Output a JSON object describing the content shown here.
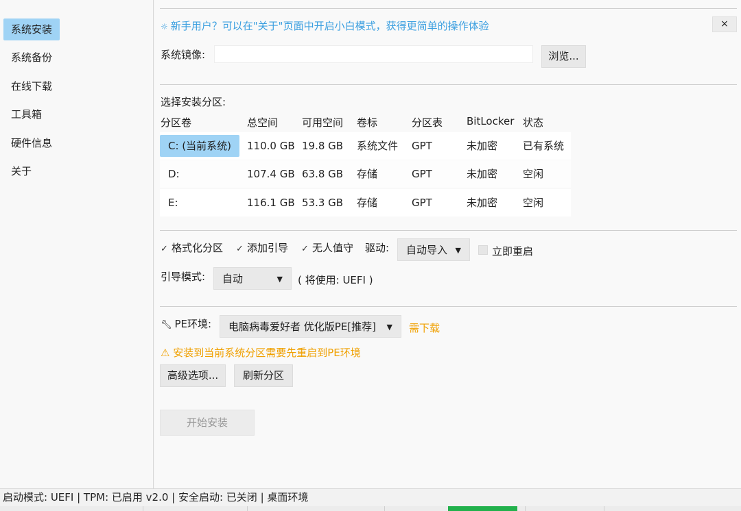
{
  "sidebar": {
    "items": [
      {
        "label": "系统安装",
        "active": true
      },
      {
        "label": "系统备份"
      },
      {
        "label": "在线下载"
      },
      {
        "label": "工具箱"
      },
      {
        "label": "硬件信息"
      },
      {
        "label": "关于"
      }
    ]
  },
  "tip": {
    "icon": "chat-bubble-icon",
    "text": "新手用户？可以在\"关于\"页面中开启小白模式，获得更简单的操作体验",
    "close_label": "×"
  },
  "image": {
    "label": "系统镜像:",
    "value": "",
    "browse_label": "浏览..."
  },
  "partitions": {
    "title": "选择安装分区:",
    "headers": [
      "分区卷",
      "总空间",
      "可用空间",
      "卷标",
      "分区表",
      "BitLocker",
      "状态"
    ],
    "rows": [
      {
        "volume": "C: (当前系统)",
        "total": "110.0 GB",
        "free": "19.8 GB",
        "label": "系统文件",
        "table": "GPT",
        "bitlocker": "未加密",
        "status": "已有系统",
        "selected": true
      },
      {
        "volume": "D:",
        "total": "107.4 GB",
        "free": "63.8 GB",
        "label": "存储",
        "table": "GPT",
        "bitlocker": "未加密",
        "status": "空闲"
      },
      {
        "volume": "E:",
        "total": "116.1 GB",
        "free": "53.3 GB",
        "label": "存储",
        "table": "GPT",
        "bitlocker": "未加密",
        "status": "空闲"
      }
    ]
  },
  "options": {
    "format": {
      "label": "格式化分区",
      "checked": true
    },
    "boot_add": {
      "label": "添加引导",
      "checked": true
    },
    "unattended": {
      "label": "无人值守",
      "checked": true
    },
    "driver_label": "驱动:",
    "driver_value": "自动导入",
    "restart": {
      "label": "立即重启",
      "checked": false
    },
    "boot_mode_label": "引导模式:",
    "boot_mode_value": "自动",
    "boot_mode_note": "( 将使用: UEFI )"
  },
  "pe": {
    "icon": "wrench-icon",
    "label": "PE环境:",
    "value": "电脑病毒爱好者 优化版PE[推荐]",
    "download_label": "需下载",
    "warning": "⚠ 安装到当前系统分区需要先重启到PE环境",
    "advanced_label": "高级选项...",
    "refresh_label": "刷新分区",
    "start_label": "开始安装"
  },
  "statusbar": {
    "text": "启动模式: UEFI | TPM: 已启用 v2.0 | 安全启动: 已关闭 | 桌面环境"
  },
  "colors": {
    "accent": "#9fd3f5",
    "tip": "#3b9fe0",
    "warning": "#f0a000"
  }
}
